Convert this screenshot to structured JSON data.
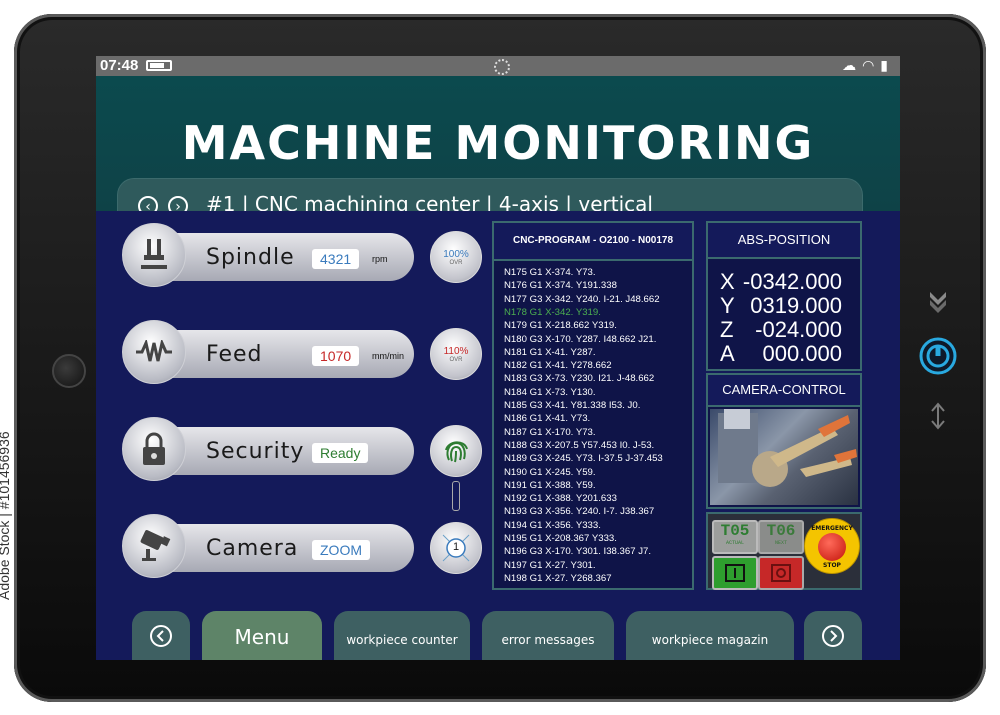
{
  "status_bar": {
    "time": "07:48",
    "icons": [
      "battery-icon",
      "loading-spinner-icon",
      "cloud-icon",
      "wifi-icon",
      "signal-icon"
    ]
  },
  "header": {
    "title": "MACHINE MONITORING",
    "machine_label": "#1 | CNC machining center | 4-axis | vertical"
  },
  "controls": [
    {
      "label": "Spindle",
      "value": "4321",
      "unit": "rpm",
      "value_color": "#3a7bbd",
      "knob_pct": "100%",
      "knob_sub": "OVR",
      "knob_color": "#3a7bbd",
      "icon": "spindle-icon"
    },
    {
      "label": "Feed",
      "value": "1070",
      "unit": "mm/min",
      "value_color": "#c62828",
      "knob_pct": "110%",
      "knob_sub": "OVR",
      "knob_color": "#c62828",
      "icon": "waveform-icon"
    },
    {
      "label": "Security",
      "value": "Ready",
      "value_color": "#2e7d32",
      "icon": "padlock-icon",
      "knob_icon": "fingerprint-icon"
    },
    {
      "label": "Camera",
      "value": "ZOOM",
      "value_color": "#3a7bbd",
      "icon": "camera-icon",
      "knob_value": "1"
    }
  ],
  "cnc_program": {
    "header": "CNC-PROGRAM - O2100 - N00178",
    "highlight_color": "#4caf50",
    "highlight_index": 3,
    "lines": [
      "N175 G1 X-374. Y73.",
      "N176 G1 X-374. Y191.338",
      "N177 G3 X-342. Y240. I-21. J48.662",
      "N178 G1 X-342. Y319.",
      "N179 G1 X-218.662 Y319.",
      "N180 G3 X-170. Y287. I48.662 J21.",
      "N181 G1 X-41. Y287.",
      "N182 G1 X-41. Y278.662",
      "N183 G3 X-73. Y230. I21. J-48.662",
      "N184 G1 X-73. Y130.",
      "N185 G3 X-41. Y81.338 I53. J0.",
      "N186 G1 X-41. Y73.",
      "N187 G1 X-170. Y73.",
      "N188 G3 X-207.5 Y57.453 I0. J-53.",
      "N189 G3 X-245. Y73. I-37.5 J-37.453",
      "N190 G1 X-245. Y59.",
      "N191 G1 X-388. Y59.",
      "N192 G1 X-388. Y201.633",
      "N193 G3 X-356. Y240. I-7. J38.367",
      "N194 G1 X-356. Y333.",
      "N195 G1 X-208.367 Y333.",
      "N196 G3 X-170. Y301. I38.367 J7.",
      "N197 G1 X-27. Y301.",
      "N198 G1 X-27. Y268.367"
    ]
  },
  "abs_position": {
    "header": "ABS-POSITION",
    "axes": [
      {
        "axis": "X",
        "value": "-0342.000"
      },
      {
        "axis": "Y",
        "value": "0319.000"
      },
      {
        "axis": "Z",
        "value": "-024.000"
      },
      {
        "axis": "A",
        "value": "000.000"
      }
    ]
  },
  "camera_control": {
    "header": "CAMERA-CONTROL"
  },
  "tools": {
    "actual": {
      "label": "T05",
      "sub": "ACTUAL",
      "color": "#2e7d32"
    },
    "next": {
      "label": "T06",
      "sub": "NEXT",
      "color": "#2e7d32"
    },
    "emergency": {
      "line1": "EMERGENCY",
      "line2": "STOP"
    }
  },
  "bottom_nav": {
    "menu": "Menu",
    "tabs": [
      "workpiece counter",
      "error messages",
      "workpiece magazin"
    ]
  },
  "watermark": {
    "side_text": "Adobe Stock | #101456936",
    "brand": "Adobe Stock"
  },
  "colors": {
    "screen_bg": "#151a5c",
    "header_bg": "#0b4a4e",
    "accent_teal": "#3e6062",
    "side_power": "#29a9e0"
  }
}
